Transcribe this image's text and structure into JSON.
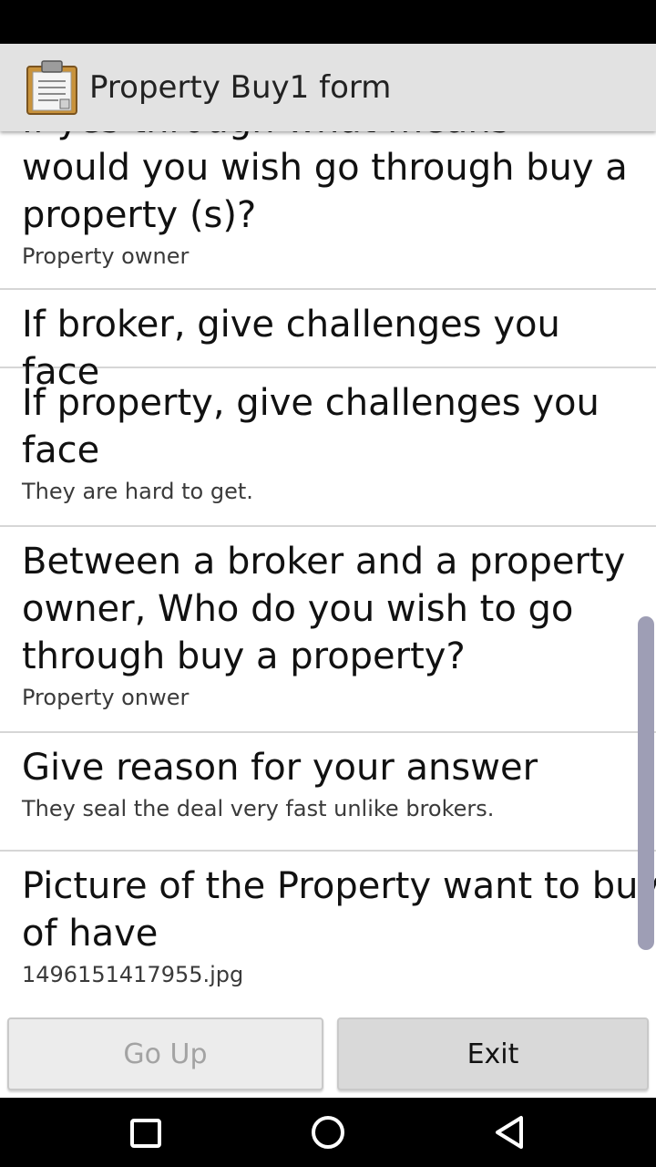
{
  "app_bar": {
    "title": "Property Buy1 form",
    "icon": "clipboard-icon"
  },
  "questions": [
    {
      "question": "If yes through what means\nwould you wish go through buy a\nproperty (s)?",
      "answer": "Property owner"
    },
    {
      "question": "If broker, give challenges you face",
      "answer": ""
    },
    {
      "question": "If property, give challenges you\nface",
      "answer": "They are hard to get."
    },
    {
      "question": "Between a broker and a property\nowner, Who do you wish to go\nthrough buy a property?",
      "answer": "Property onwer"
    },
    {
      "question": "Give reason for your answer",
      "answer": "They seal the deal very fast unlike brokers."
    },
    {
      "question": "Picture of the Property want to buy\nof have",
      "answer": "1496151417955.jpg"
    }
  ],
  "buttons": {
    "go_up": "Go Up",
    "exit": "Exit"
  },
  "nav": {
    "recents": "square-recents-icon",
    "home": "circle-home-icon",
    "back": "triangle-back-icon"
  },
  "colors": {
    "app_bar_bg": "#e2e2e2",
    "scrollbar": "#9e9eb5",
    "divider": "#d6d6d6"
  }
}
